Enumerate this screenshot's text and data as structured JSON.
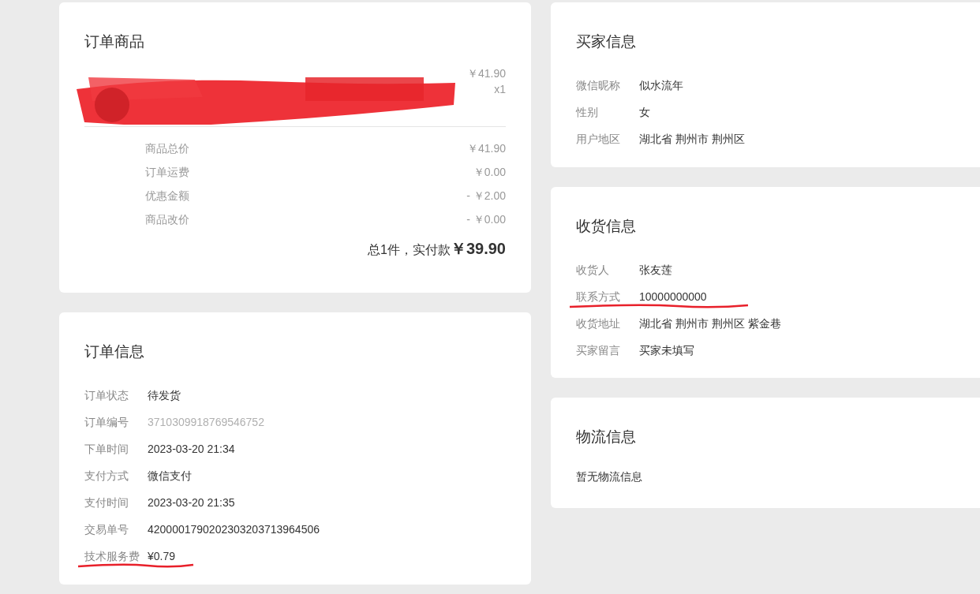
{
  "order_goods": {
    "title": "订单商品",
    "item": {
      "price": "￥41.90",
      "quantity": "x1"
    },
    "summary": [
      {
        "label": "商品总价",
        "value": "￥41.90"
      },
      {
        "label": "订单运费",
        "value": "￥0.00"
      },
      {
        "label": "优惠金额",
        "value": "- ￥2.00"
      },
      {
        "label": "商品改价",
        "value": "- ￥0.00"
      }
    ],
    "total_label": "总1件，实付款",
    "total_value": "￥39.90"
  },
  "order_info": {
    "title": "订单信息",
    "rows": [
      {
        "label": "订单状态",
        "value": "待发货"
      },
      {
        "label": "订单编号",
        "value": "3710309918769546752",
        "faded": true
      },
      {
        "label": "下单时间",
        "value": "2023-03-20 21:34"
      },
      {
        "label": "支付方式",
        "value": "微信支付"
      },
      {
        "label": "支付时间",
        "value": "2023-03-20 21:35"
      },
      {
        "label": "交易单号",
        "value": "4200001790202303203713964506"
      },
      {
        "label": "技术服务费",
        "value": "¥0.79",
        "underlined": true
      }
    ]
  },
  "buyer_info": {
    "title": "买家信息",
    "rows": [
      {
        "label": "微信昵称",
        "value": "似水流年"
      },
      {
        "label": "性别",
        "value": "女"
      },
      {
        "label": "用户地区",
        "value": "湖北省 荆州市 荆州区"
      }
    ]
  },
  "shipping_info": {
    "title": "收货信息",
    "rows": [
      {
        "label": "收货人",
        "value": "张友莲"
      },
      {
        "label": "联系方式",
        "value": "10000000000",
        "underlined": true
      },
      {
        "label": "收货地址",
        "value": "湖北省  荆州市  荆州区  紫金巷"
      },
      {
        "label": "买家留言",
        "value": "买家未填写"
      }
    ]
  },
  "logistics_info": {
    "title": "物流信息",
    "message": "暂无物流信息"
  }
}
